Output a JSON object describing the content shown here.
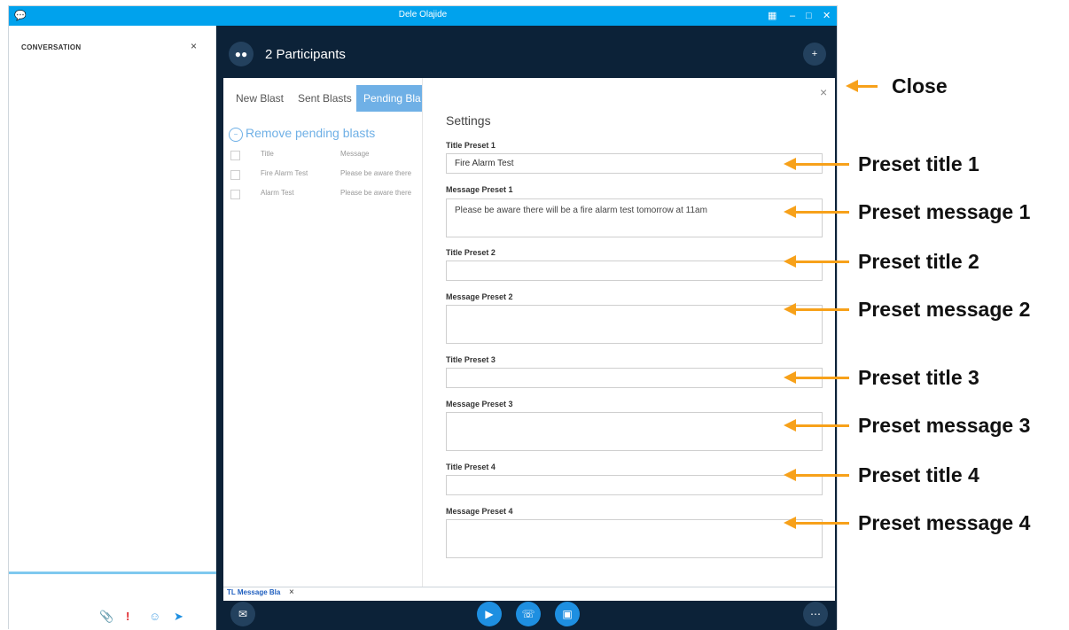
{
  "window": {
    "title": "Dele Olajide"
  },
  "left_pane": {
    "conversation_label": "CONVERSATION",
    "close": "×"
  },
  "header": {
    "participants": "2 Participants"
  },
  "blast_tabs": [
    "New Blast",
    "Sent Blasts",
    "Pending Bla"
  ],
  "pending": {
    "remove_label": "Remove pending blasts",
    "columns": [
      "Title",
      "Message"
    ],
    "rows": [
      {
        "title": "Fire Alarm Test",
        "message": "Please be aware there"
      },
      {
        "title": "Alarm Test",
        "message": "Please be aware there"
      }
    ]
  },
  "settings": {
    "heading": "Settings",
    "close": "×",
    "fields": [
      {
        "label": "Title Preset 1",
        "value": "Fire Alarm Test"
      },
      {
        "label": "Message Preset 1",
        "value": "Please be aware there will be a fire alarm test tomorrow at 11am"
      },
      {
        "label": "Title Preset 2",
        "value": ""
      },
      {
        "label": "Message Preset 2",
        "value": ""
      },
      {
        "label": "Title Preset 3",
        "value": ""
      },
      {
        "label": "Message Preset 3",
        "value": ""
      },
      {
        "label": "Title Preset 4",
        "value": ""
      },
      {
        "label": "Message Preset 4",
        "value": ""
      }
    ]
  },
  "bottom_tab": {
    "label": "TL Message Bla",
    "close": "×"
  },
  "annotations": {
    "close": "Close",
    "preset_title_1": "Preset title 1",
    "preset_message_1": "Preset message 1",
    "preset_title_2": "Preset title 2",
    "preset_message_2": "Preset message 2",
    "preset_title_3": "Preset title 3",
    "preset_message_3": "Preset message 3",
    "preset_title_4": "Preset title 4",
    "preset_message_4": "Preset message 4"
  },
  "colors": {
    "titlebar": "#00a2ed",
    "main_bg": "#0c2238",
    "accent": "#6fb0e6",
    "arrow": "#f7a11a",
    "call_buttons": "#1e8fe1"
  },
  "icons": [
    "chat-logo-icon",
    "layout-icon",
    "minimize-icon",
    "maximize-icon",
    "window-close-icon",
    "participants-icon",
    "add-person-icon",
    "attach-icon",
    "importance-icon",
    "emoji-icon",
    "send-icon",
    "chat-icon",
    "video-icon",
    "phone-icon",
    "screen-share-icon",
    "more-icon"
  ]
}
